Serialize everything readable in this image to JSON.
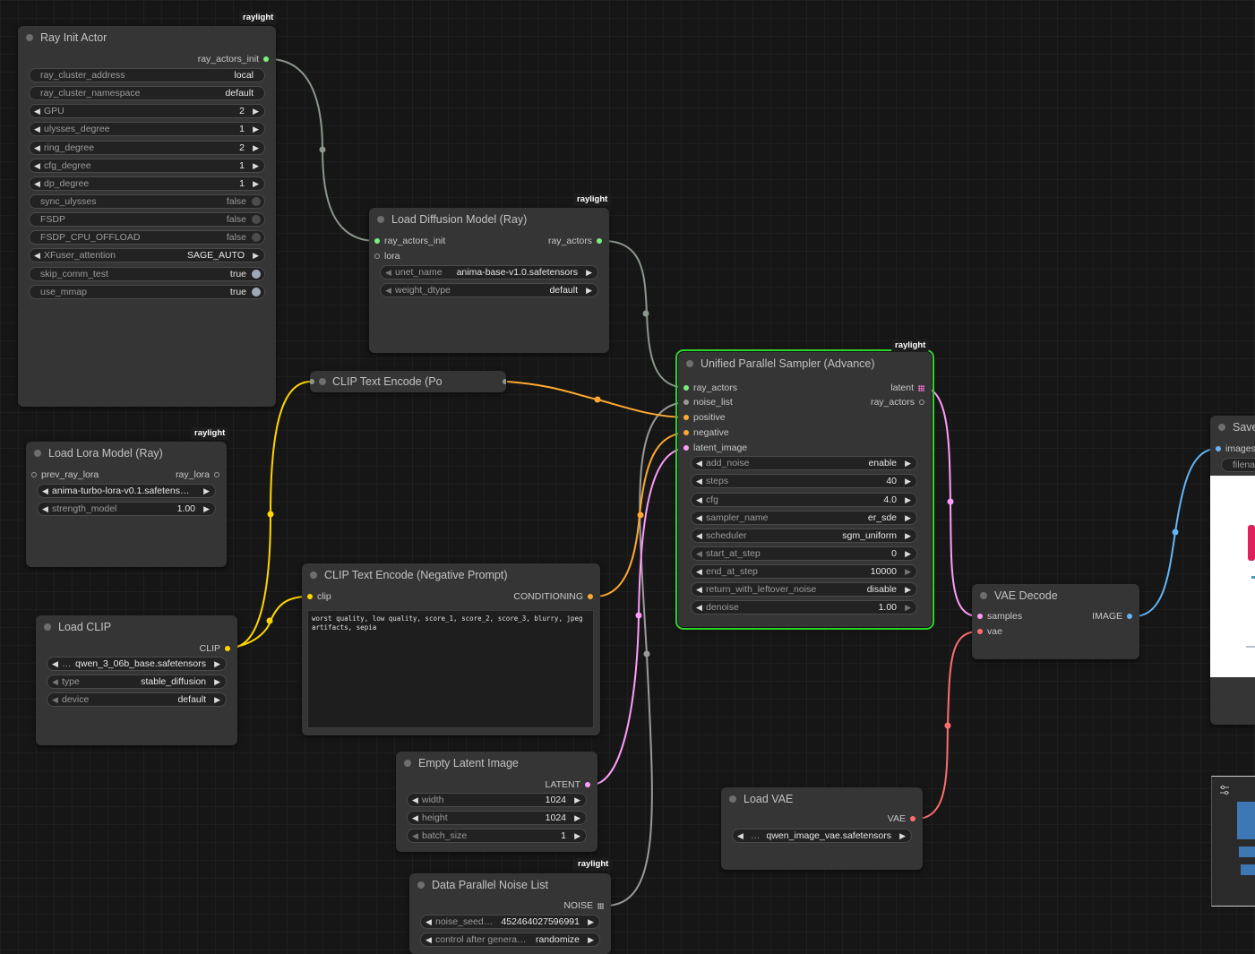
{
  "badge": "raylight",
  "ray_init": {
    "title": "Ray Init Actor",
    "output": "ray_actors_init",
    "widgets": [
      {
        "label": "ray_cluster_address",
        "value": "local"
      },
      {
        "label": "ray_cluster_namespace",
        "value": "default"
      },
      {
        "label": "GPU",
        "value": "2"
      },
      {
        "label": "ulysses_degree",
        "value": "1"
      },
      {
        "label": "ring_degree",
        "value": "2"
      },
      {
        "label": "cfg_degree",
        "value": "1"
      },
      {
        "label": "dp_degree",
        "value": "1"
      },
      {
        "label": "sync_ulysses",
        "value": "false"
      },
      {
        "label": "FSDP",
        "value": "false"
      },
      {
        "label": "FSDP_CPU_OFFLOAD",
        "value": "false"
      },
      {
        "label": "XFuser_attention",
        "value": "SAGE_AUTO"
      },
      {
        "label": "skip_comm_test",
        "value": "true"
      },
      {
        "label": "use_mmap",
        "value": "true"
      }
    ]
  },
  "load_diffusion": {
    "title": "Load Diffusion Model (Ray)",
    "inputs": [
      "ray_actors_init",
      "lora"
    ],
    "output": "ray_actors",
    "widgets": [
      {
        "label": "unet_name",
        "value": "anima-base-v1.0.safetensors"
      },
      {
        "label": "weight_dtype",
        "value": "default"
      }
    ]
  },
  "clip_pos": {
    "title": "CLIP Text Encode (Po"
  },
  "load_lora": {
    "title": "Load Lora Model (Ray)",
    "input": "prev_ray_lora",
    "output": "ray_lora",
    "widgets": [
      {
        "label": "",
        "value": "anima-turbo-lora-v0.1.safetens…"
      },
      {
        "label": "strength_model",
        "value": "1.00"
      }
    ]
  },
  "clip_neg": {
    "title": "CLIP Text Encode (Negative Prompt)",
    "input": "clip",
    "output": "CONDITIONING",
    "text": "worst quality, low quality, score_1, score_2, score_3, blurry, jpeg artifacts, sepia"
  },
  "load_clip": {
    "title": "Load CLIP",
    "output": "CLIP",
    "widgets": [
      {
        "label": "…",
        "value": "qwen_3_06b_base.safetensors"
      },
      {
        "label": "type",
        "value": "stable_diffusion"
      },
      {
        "label": "device",
        "value": "default"
      }
    ]
  },
  "sampler": {
    "title": "Unified Parallel Sampler (Advance)",
    "inputs": [
      "ray_actors",
      "noise_list",
      "positive",
      "negative",
      "latent_image"
    ],
    "outputs": [
      "latent",
      "ray_actors"
    ],
    "widgets": [
      {
        "label": "add_noise",
        "value": "enable"
      },
      {
        "label": "steps",
        "value": "40"
      },
      {
        "label": "cfg",
        "value": "4.0"
      },
      {
        "label": "sampler_name",
        "value": "er_sde"
      },
      {
        "label": "scheduler",
        "value": "sgm_uniform"
      },
      {
        "label": "start_at_step",
        "value": "0"
      },
      {
        "label": "end_at_step",
        "value": "10000"
      },
      {
        "label": "return_with_leftover_noise",
        "value": "disable"
      },
      {
        "label": "denoise",
        "value": "1.00"
      }
    ]
  },
  "vae_decode": {
    "title": "VAE Decode",
    "inputs": [
      "samples",
      "vae"
    ],
    "output": "IMAGE"
  },
  "save": {
    "title": "Save",
    "input": "images",
    "widget": "filena"
  },
  "empty_latent": {
    "title": "Empty Latent Image",
    "output": "LATENT",
    "widgets": [
      {
        "label": "width",
        "value": "1024"
      },
      {
        "label": "height",
        "value": "1024"
      },
      {
        "label": "batch_size",
        "value": "1"
      }
    ]
  },
  "load_vae": {
    "title": "Load VAE",
    "output": "VAE",
    "widgets": [
      {
        "label": "…",
        "value": "qwen_image_vae.safetensors"
      }
    ]
  },
  "noise_list": {
    "title": "Data Parallel Noise List",
    "output": "NOISE",
    "widgets": [
      {
        "label": "noise_seed…",
        "value": "452464027596991"
      },
      {
        "label": "control after genera…",
        "value": "randomize"
      }
    ]
  },
  "colors": {
    "background": "#161616",
    "node": "#353535",
    "selected_outline": "#2fd12f",
    "link_gray": "#8c978c",
    "link_conditioning": "#ffa931",
    "link_clip": "#ffd500",
    "link_latent": "#ff9cf9",
    "link_image": "#64b5f6",
    "link_vae": "#ff6e6e"
  },
  "icons": {
    "arrow_left": "◀",
    "arrow_right": "▶"
  }
}
